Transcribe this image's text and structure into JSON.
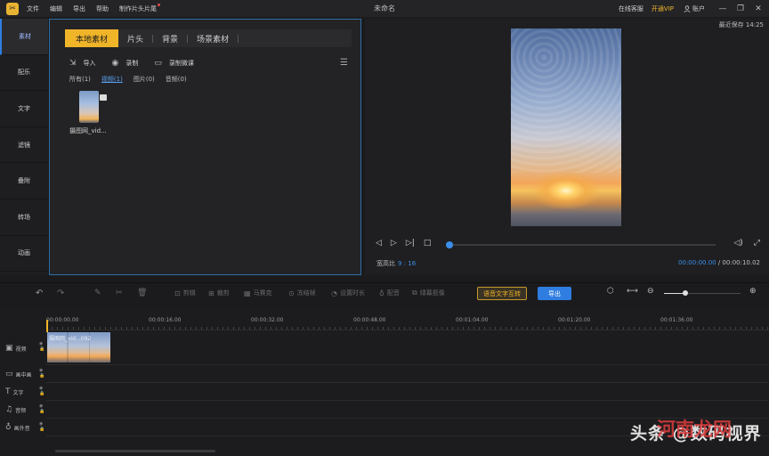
{
  "titlebar": {
    "menu": [
      "文件",
      "编辑",
      "导出",
      "帮助",
      "制作片头片尾"
    ],
    "window_title": "未命名",
    "online_help": "在线客服",
    "vip": "开通VIP",
    "account": "账户",
    "win_buttons": [
      "—",
      "❐",
      "✕"
    ]
  },
  "sidebar": {
    "items": [
      {
        "label": "素材",
        "active": true
      },
      {
        "label": "配乐"
      },
      {
        "label": "文字"
      },
      {
        "label": "滤镜"
      },
      {
        "label": "叠附"
      },
      {
        "label": "转场"
      },
      {
        "label": "动画"
      }
    ]
  },
  "media": {
    "tabs": [
      "本地素材",
      "片头",
      "背景",
      "场景素材"
    ],
    "tools": [
      "导入",
      "录制",
      "录制微课"
    ],
    "filters": [
      "所有(1)",
      "视频(1)",
      "图片(0)",
      "音频(0)"
    ],
    "file_name": "摄图网_vid..."
  },
  "preview": {
    "autosave": "最近保存 14:25",
    "ratio_label": "宽高比",
    "ratio_value": "9 : 16",
    "time_current": "00:00:00.00",
    "time_total": "/ 00:00:10.02",
    "progress": 0.0
  },
  "edit_toolbar": {
    "items": [
      "剪辑",
      "裁剪",
      "马赛克",
      "冻结帧",
      "设置时长",
      "配音",
      "绿幕抠像"
    ],
    "speech_button": "语音文字互转",
    "export_button": "导出",
    "zoom_level": 0.27
  },
  "timeline": {
    "ticks": [
      "00:00:00.00",
      "00:00:16.00",
      "00:00:32.00",
      "00:00:48.00",
      "00:01:04.00",
      "00:01:20.00",
      "00:01:36.00"
    ],
    "tracks": [
      "视频",
      "画中画",
      "文字",
      "音频",
      "画外音"
    ],
    "clip_label": "摄图网_vid...092"
  },
  "watermark": {
    "text": "头条 @数码视界",
    "overlay": "河南龙网"
  }
}
